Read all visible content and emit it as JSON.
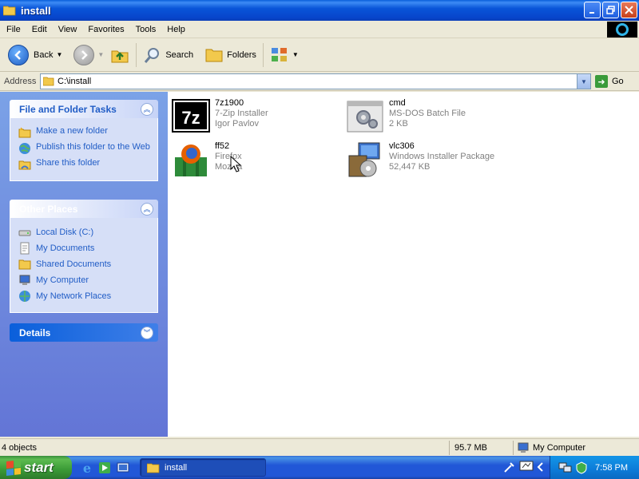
{
  "window": {
    "title": "install"
  },
  "menu": [
    "File",
    "Edit",
    "View",
    "Favorites",
    "Tools",
    "Help"
  ],
  "toolbar": {
    "back_label": "Back",
    "search_label": "Search",
    "folders_label": "Folders"
  },
  "address": {
    "label": "Address",
    "value": "C:\\install",
    "go_label": "Go"
  },
  "tasks": {
    "header": "File and Folder Tasks",
    "items": [
      {
        "label": "Make a new folder",
        "icon": "new-folder-icon"
      },
      {
        "label": "Publish this folder to the Web",
        "icon": "publish-web-icon"
      },
      {
        "label": "Share this folder",
        "icon": "share-folder-icon"
      }
    ]
  },
  "places": {
    "header": "Other Places",
    "items": [
      {
        "label": "Local Disk (C:)",
        "icon": "local-disk-icon"
      },
      {
        "label": "My Documents",
        "icon": "my-documents-icon"
      },
      {
        "label": "Shared Documents",
        "icon": "shared-documents-icon"
      },
      {
        "label": "My Computer",
        "icon": "my-computer-icon"
      },
      {
        "label": "My Network Places",
        "icon": "network-places-icon"
      }
    ]
  },
  "details": {
    "header": "Details"
  },
  "files": [
    {
      "name": "7z1900",
      "line2": "7-Zip Installer",
      "line3": "Igor Pavlov",
      "icon": "7zip-icon"
    },
    {
      "name": "cmd",
      "line2": "MS-DOS Batch File",
      "line3": "2 KB",
      "icon": "batch-file-icon"
    },
    {
      "name": "ff52",
      "line2": "Firefox",
      "line3": "Mozilla",
      "icon": "firefox-installer-icon"
    },
    {
      "name": "vlc306",
      "line2": "Windows Installer Package",
      "line3": "52,447 KB",
      "icon": "msi-package-icon"
    }
  ],
  "status": {
    "objects": "4 objects",
    "size": "95.7 MB",
    "location": "My Computer"
  },
  "taskbar": {
    "start_label": "start",
    "task_label": "install",
    "clock": "7:58 PM"
  },
  "colors": {
    "title_blue": "#0A5FDB",
    "panel_link": "#215DC6",
    "start_green": "#3A9A36"
  }
}
